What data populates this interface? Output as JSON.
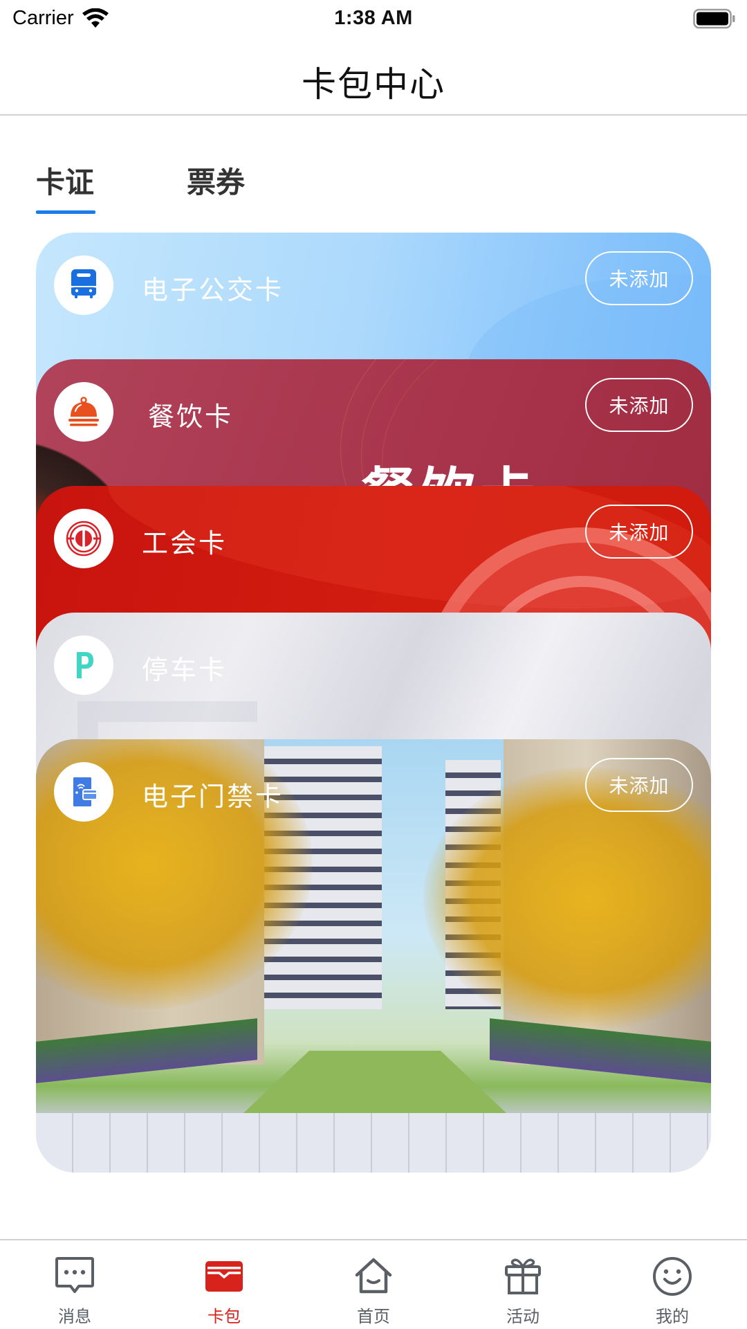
{
  "status_bar": {
    "carrier": "Carrier",
    "time": "1:38 AM"
  },
  "header": {
    "title": "卡包中心"
  },
  "tabs": [
    {
      "label": "卡证",
      "active": true
    },
    {
      "label": "票券",
      "active": false
    }
  ],
  "colors": {
    "accent_blue": "#1a7ce8",
    "tab_active_red": "#d7231c",
    "tab_inactive_gray": "#5a5f66"
  },
  "cards": [
    {
      "name": "电子公交卡",
      "icon": "bus-icon",
      "button": "未添加",
      "theme": "light-blue"
    },
    {
      "name": "餐饮卡",
      "icon": "food-cloche-icon",
      "button": "未添加",
      "theme": "crimson",
      "watermark": "餐饮卡"
    },
    {
      "name": "工会卡",
      "icon": "trade-union-emblem-icon",
      "button": "未添加",
      "theme": "red"
    },
    {
      "name": "停车卡",
      "icon": "parking-icon",
      "theme": "silver"
    },
    {
      "name": "电子门禁卡",
      "icon": "door-access-card-icon",
      "button": "未添加",
      "theme": "residential-photo"
    }
  ],
  "tab_bar": {
    "items": [
      {
        "label": "消息",
        "icon": "message-icon",
        "active": false
      },
      {
        "label": "卡包",
        "icon": "wallet-icon",
        "active": true
      },
      {
        "label": "首页",
        "icon": "home-icon",
        "active": false
      },
      {
        "label": "活动",
        "icon": "gift-icon",
        "active": false
      },
      {
        "label": "我的",
        "icon": "smiley-icon",
        "active": false
      }
    ]
  }
}
